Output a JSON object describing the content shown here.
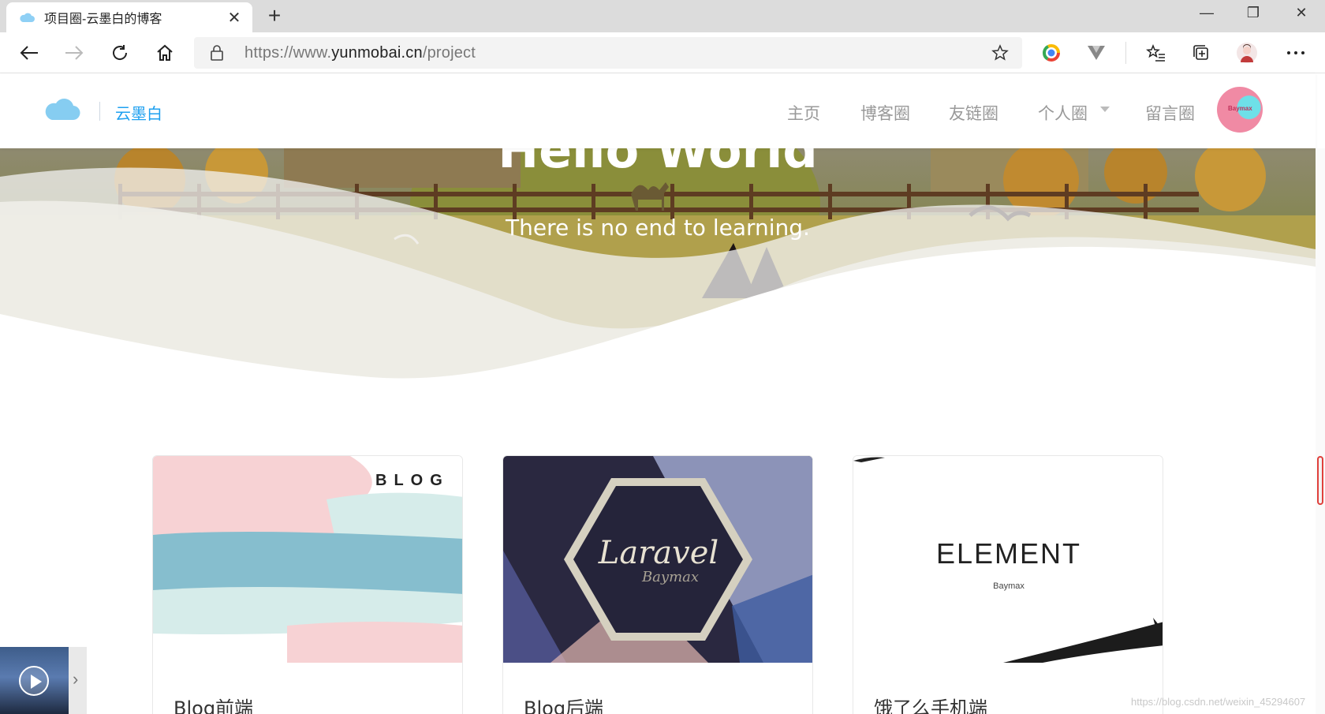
{
  "browser": {
    "tab_title": "项目圈-云墨白的博客",
    "url_prefix": "https://www.",
    "url_domain": "yunmobai.cn",
    "url_path": "/project",
    "icons": [
      "cloud-icon",
      "close-icon",
      "plus-icon",
      "minimize-icon",
      "restore-icon",
      "back-icon",
      "forward-icon",
      "refresh-icon",
      "home-icon",
      "lock-icon",
      "star-icon",
      "extension-icon",
      "favorites-icon",
      "collections-icon",
      "profile-icon",
      "more-icon"
    ]
  },
  "site": {
    "logo_text": "云墨白",
    "nav": [
      "主页",
      "博客圈",
      "友链圈",
      "个人圈",
      "留言圈"
    ],
    "avatar_text": "Baymax"
  },
  "hero": {
    "title": "Hello World",
    "subtitle": "There is no end to learning."
  },
  "cards": [
    {
      "title": "Blog前端",
      "image_text": "BLOG"
    },
    {
      "title": "Blog后端",
      "image_text": "Laravel",
      "image_subtext": "Baymax"
    },
    {
      "title": "饿了么手机端",
      "image_text": "ELEMENT",
      "image_subtext": "Baymax"
    }
  ],
  "watermark": "https://blog.csdn.net/weixin_45294607",
  "colors": {
    "brand": "#1ea0f0",
    "nav_text": "#999999",
    "scroll_accent": "#e0403c"
  }
}
